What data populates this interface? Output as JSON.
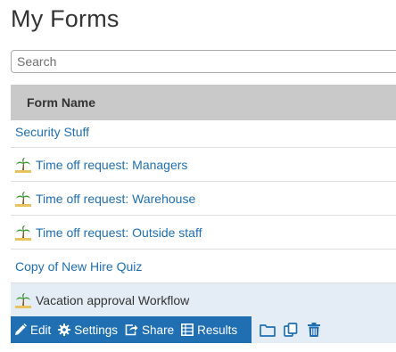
{
  "page": {
    "title": "My Forms"
  },
  "search": {
    "placeholder": "Search",
    "value": ""
  },
  "table": {
    "header": "Form Name",
    "rows": [
      {
        "name": "Security Stuff",
        "icon": null
      },
      {
        "name": "Time off request: Managers",
        "icon": "palm-tree-icon"
      },
      {
        "name": "Time off request: Warehouse",
        "icon": "palm-tree-icon"
      },
      {
        "name": "Time off request: Outside staff",
        "icon": "palm-tree-icon"
      },
      {
        "name": "Copy of New Hire Quiz",
        "icon": null
      },
      {
        "name": "Vacation approval Workflow",
        "icon": "palm-tree-icon",
        "selected": true
      }
    ]
  },
  "actions": {
    "edit": "Edit",
    "settings": "Settings",
    "share": "Share",
    "results": "Results",
    "tools": [
      "folder-icon",
      "copy-icon",
      "trash-icon"
    ]
  },
  "colors": {
    "link": "#1f6fb2",
    "header_bg": "#c9c9c9",
    "selected_bg": "#e4edf5",
    "action_bg": "#1f6fb2"
  }
}
